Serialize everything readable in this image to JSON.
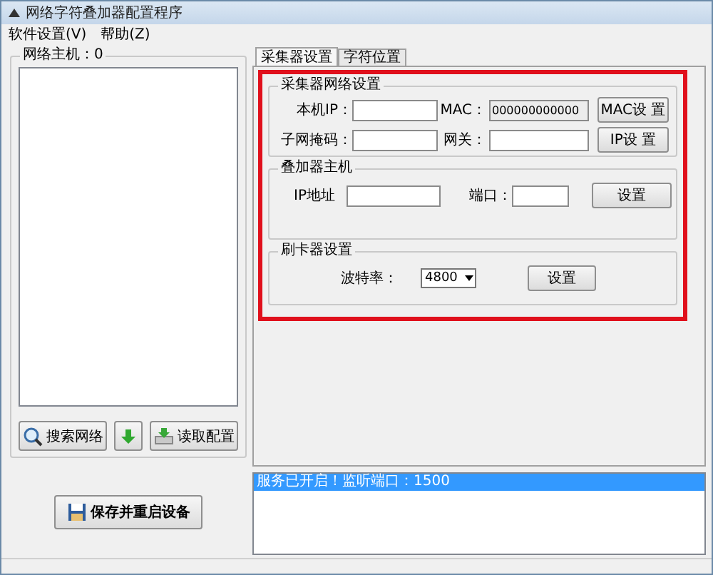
{
  "window": {
    "title": "网络字符叠加器配置程序"
  },
  "menu": [
    {
      "label": "软件设置(V)"
    },
    {
      "label": "帮助(Z)"
    }
  ],
  "host_panel": {
    "title": "网络主机：0",
    "buttons": [
      {
        "kind": "search",
        "label": "搜索网络"
      },
      {
        "kind": "arrow"
      },
      {
        "kind": "read",
        "label": "读取配置"
      }
    ]
  },
  "save_button": "保存并重启设备",
  "tabs": [
    {
      "label": "采集器设置",
      "selected": true
    },
    {
      "label": "字符位置",
      "selected": false
    }
  ],
  "network_group": {
    "title": "采集器网络设置",
    "rows": [
      {
        "label": "本机IP：",
        "value": "",
        "label2": "MAC：",
        "value2": "000000000000",
        "value2_disabled": true,
        "button": "MAC设 置"
      },
      {
        "label": "子网掩码：",
        "value": "",
        "label2": "网关：",
        "value2": "",
        "value2_disabled": false,
        "button": "IP设 置"
      }
    ]
  },
  "overlay_group": {
    "title": "叠加器主机",
    "ip_label": "IP地址",
    "port_label": "端口：",
    "button": "设置"
  },
  "card_group": {
    "title": "刷卡器设置",
    "baud_label": "波特率：",
    "baud_value": "4800",
    "button": "设置"
  },
  "log": [
    {
      "text": "服务已开启！监听端口：1500",
      "selected": true
    }
  ]
}
